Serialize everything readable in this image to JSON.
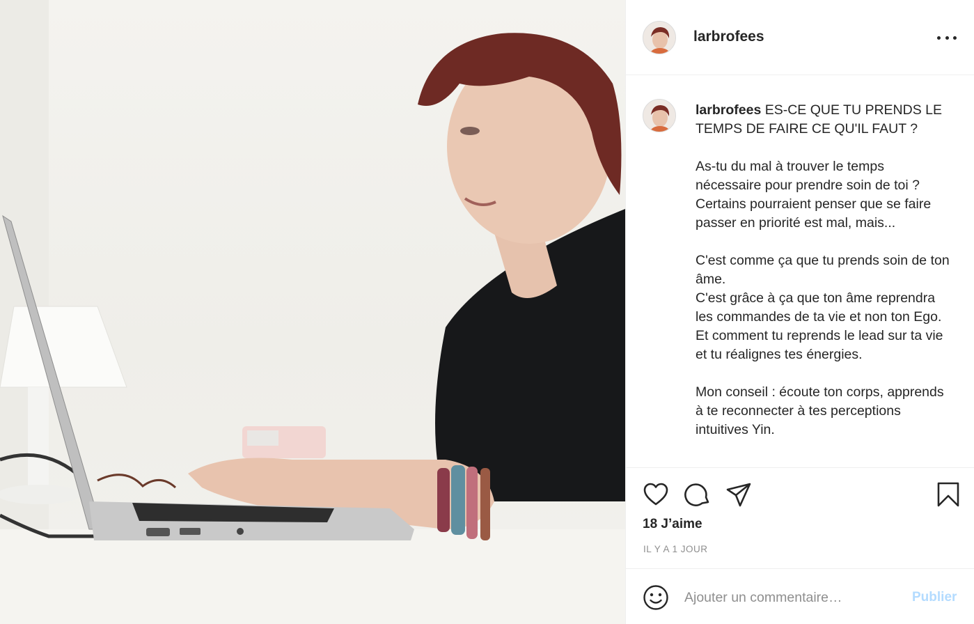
{
  "post": {
    "username": "larbrofees",
    "photo_alt": "Photo de larbrofees"
  },
  "caption": {
    "username": "larbrofees",
    "text": " ES-CE QUE TU PRENDS LE TEMPS DE FAIRE CE QU'IL FAUT ?\n\nAs-tu du mal à trouver le temps nécessaire pour prendre soin de toi ? Certains pourraient penser que se faire passer en priorité est mal, mais...\n\nC'est comme ça que tu prends soin de ton âme.\nC'est grâce à ça que ton âme reprendra les commandes de ta vie et non ton Ego.\nEt comment tu reprends le lead sur ta vie et tu réalignes tes énergies.\n\nMon conseil : écoute ton corps, apprends à te reconnecter à tes perceptions intuitives Yin."
  },
  "engagement": {
    "likes": "18 J’aime",
    "time": "IL Y A 1 JOUR"
  },
  "comment": {
    "placeholder": "Ajouter un commentaire…",
    "publish_label": "Publier"
  },
  "icons": {
    "like": "heart-icon",
    "comment": "speech-bubble-icon",
    "share": "paper-plane-icon",
    "save": "bookmark-icon",
    "more": "more-dots-icon",
    "emoji": "smiley-icon"
  },
  "colors": {
    "publish_disabled": "#b3dbff",
    "secondary_text": "#8e8e8e",
    "primary_text": "#262626"
  }
}
